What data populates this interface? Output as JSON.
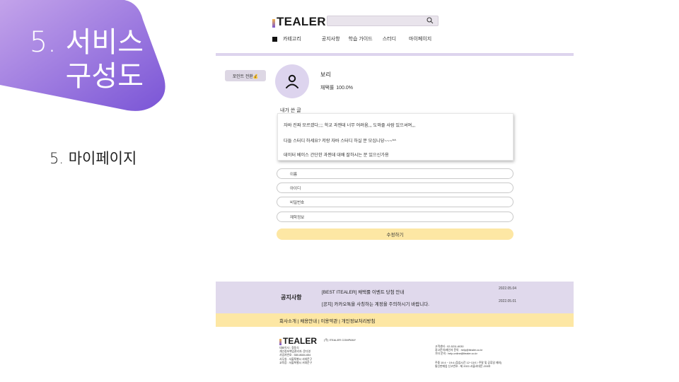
{
  "slide": {
    "title_line1": "5. 서비스",
    "title_line2": "구성도",
    "subtitle": "5. 마이페이지"
  },
  "colors": {
    "blob_gradient": [
      "#b38fe3",
      "#7a55d6"
    ],
    "accent_lavender": "#ddd4ee",
    "accent_yellow": "#fde7a4"
  },
  "header": {
    "logo": "TEALER",
    "search_placeholder": "",
    "search_icon": "search-icon",
    "nav": {
      "menu_icon": "menu-square-icon",
      "category": "카테고리",
      "notice": "공지사항",
      "study_guide": "학습 가이드",
      "study": "스터디",
      "mypage": "마이페이지"
    }
  },
  "profile": {
    "point_button": "포인트 전환💰",
    "avatar_icon": "user-icon",
    "name": "보리",
    "rate_label": "채택률",
    "rate_value": "100.0%"
  },
  "posts": {
    "label": "내가 쓴 글",
    "items": [
      "자바 진짜 모르겠다;;;; 학교 과젠데 너무 어려움,,, 도와줄 사람 있으셔여,,,",
      "다들 스터디 하세요? 저랑 자바 스터디 하실 분 모십니당~~~^^",
      "데이터 베이스 간단한 과젠데 대배 잘하시는 분 있으신가용"
    ]
  },
  "form": {
    "fields": [
      "이름",
      "아이디",
      "비밀번호",
      "재학정보"
    ],
    "submit": "수정하기"
  },
  "notice": {
    "title": "공지사항",
    "items": [
      {
        "text": "[BEST ITEALER] 채택률 이벤트 당첨 안내",
        "date": "2022.05.04"
      },
      {
        "text": "[공지] 카카오톡을 사칭하는 계정을 주의하시기 바랍니다.",
        "date": "2022.05.01"
      }
    ]
  },
  "footer": {
    "links": "회사소개 | 채용안내 | 이용약관 | 개인정보처리방침",
    "logo": "TEALER",
    "company": "(주) ITEALER COMPANY",
    "left_lines": [
      "대표이사 : 정동식",
      "개인정보책임관리자: 윤다영",
      "사업자번호 : 580-8684-654",
      "사무실 : 서울특별시 서대문구",
      "교육장 : 서울특별시 서대문구"
    ],
    "right_lines": [
      "고객센터 : 02-5211-6030",
      "광고문의/제안서 문의 : help@itealer.co.kr",
      "기타 문의 : help.online@itealer.co.kr"
    ],
    "right_lines2": [
      "주중 10:4 ~ 19:4 (점심시간 12~13시 / 주말 및 공휴일 제외)",
      "통신판매업 신고번호 : 제 2022-서울서대문-203호"
    ]
  }
}
